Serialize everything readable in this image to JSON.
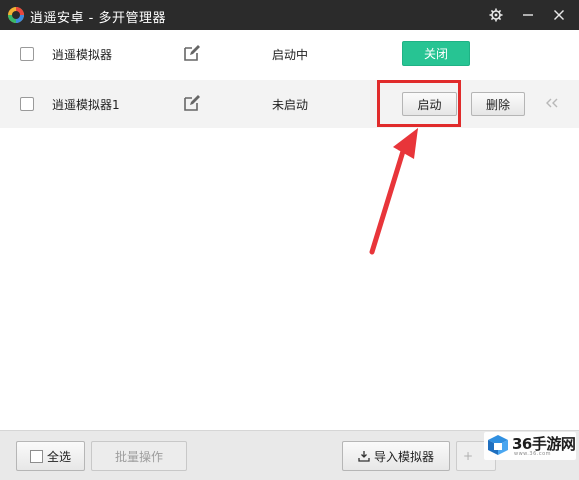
{
  "window": {
    "title": "逍遥安卓 - 多开管理器",
    "icons": {
      "logo": "xiaoyao-logo-icon",
      "settings": "gear-icon",
      "minimize": "minimize-icon",
      "close": "close-icon"
    }
  },
  "emulators": [
    {
      "name": "逍遥模拟器",
      "status": "启动中",
      "action_label": "关闭",
      "selected": false
    },
    {
      "name": "逍遥模拟器1",
      "status": "未启动",
      "action_label": "启动",
      "delete_label": "删除",
      "expand_icon": "double-chevron-left-icon",
      "selected": false
    }
  ],
  "row_icons": {
    "edit": "edit-icon"
  },
  "annotation": {
    "highlight_color": "#e02b2b"
  },
  "footer": {
    "select_all_label": "全选",
    "batch_label": "批量操作",
    "import_label": "导入模拟器",
    "import_icon": "import-icon",
    "partial_label": "+"
  },
  "watermark": {
    "main": "36手游网",
    "sub": "www.36.com"
  },
  "colors": {
    "titlebar": "#2b2b2b",
    "running_button": "#27c493",
    "footer": "#e9e9e9",
    "alt_row": "#f3f3f3"
  }
}
